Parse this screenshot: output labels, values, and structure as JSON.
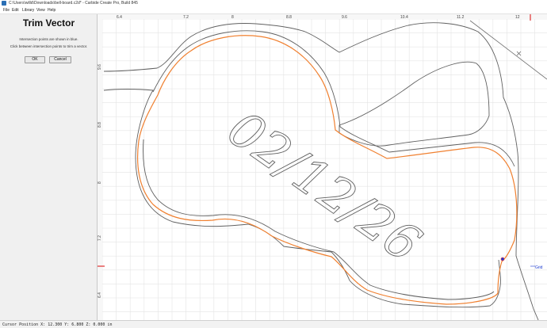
{
  "window": {
    "title": "C:\\Users\\willd\\Downloads\\bell-board.c2d* - Carbide Create Pro, Build 845"
  },
  "menu": {
    "file": "File",
    "edit": "Edit",
    "library": "Library",
    "view": "View",
    "help": "Help"
  },
  "panel": {
    "title": "Trim Vector",
    "line1": "Intersection points are shown in blue.",
    "line2": "Click between intersection points to trim a vector.",
    "ok_label": "OK",
    "cancel_label": "Cancel"
  },
  "ruler": {
    "top_ticks": [
      "6.4",
      "7.2",
      "8",
      "8.8",
      "9.6",
      "10.4",
      "11.2",
      "12"
    ],
    "left_ticks": [
      "9.6",
      "8.8",
      "8",
      "7.2",
      "6.4"
    ]
  },
  "canvas": {
    "engraved_text": "02/12/26",
    "grid_label": "Grid"
  },
  "status": {
    "cursor_text": "Cursor Position X: 12.300 Y: 6.800 Z: 0.000 in"
  },
  "colors": {
    "selected_vector": "#f08030",
    "vector": "#606060",
    "grid": "#e4e4e4",
    "marker": "#e03030",
    "intersection": "#1a3ad0"
  }
}
